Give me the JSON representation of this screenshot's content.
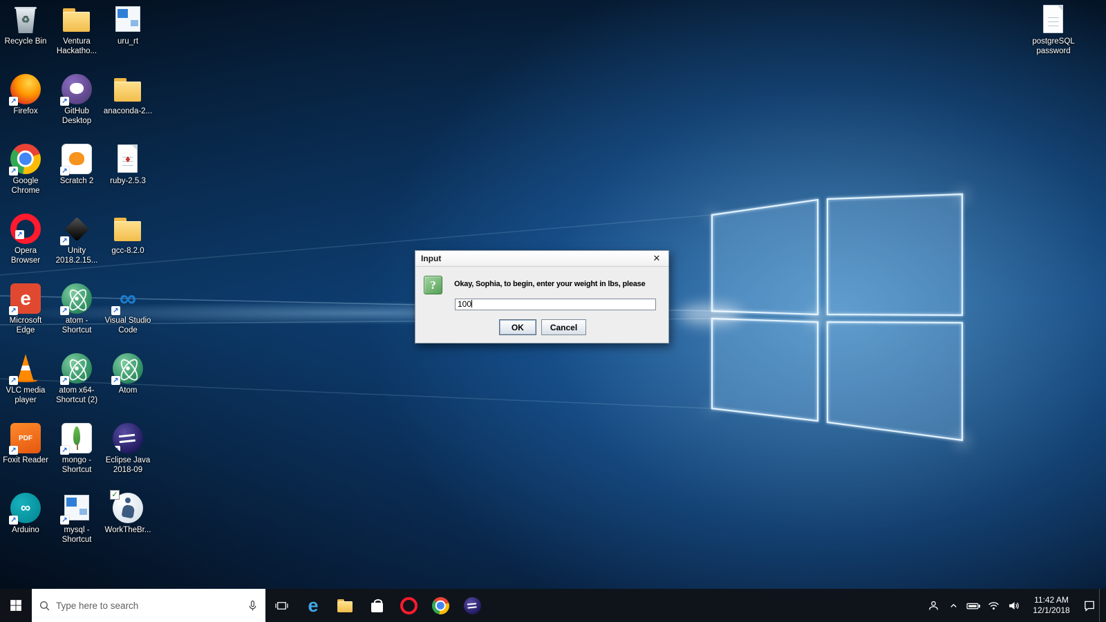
{
  "colors": {
    "taskbar_bg": "#10141a",
    "dialog_bg": "#eeeeee",
    "accent_blue": "#2f7fd6",
    "opera_red": "#ff1b2d",
    "folder_yellow": "#f2bd4c"
  },
  "dialog": {
    "title": "Input",
    "close_glyph": "✕",
    "icon_glyph": "?",
    "message": "Okay, Sophia, to begin, enter your weight in lbs, please",
    "input_value": "100",
    "buttons": {
      "ok": "OK",
      "cancel": "Cancel"
    }
  },
  "taskbar": {
    "search_placeholder": "Type here to search",
    "left_icons": [
      "windows-start",
      "search",
      "microphone",
      "task-view"
    ],
    "apps": [
      {
        "id": "edge",
        "shape": "plain",
        "glyph": "e",
        "glyphColor": "#41a8e8",
        "glyphSize": 27
      },
      {
        "id": "file-explorer",
        "shape": "folder"
      },
      {
        "id": "store",
        "shape": "bag"
      },
      {
        "id": "opera",
        "shape": "ring",
        "color": "#ff1b2d"
      },
      {
        "id": "chrome",
        "shape": "chrome"
      },
      {
        "id": "eclipse",
        "shape": "eclipse"
      }
    ],
    "tray": [
      "people",
      "chevron-up",
      "battery",
      "network",
      "volume"
    ],
    "clock": {
      "time": "11:42 AM",
      "date": "12/1/2018"
    },
    "action_center": "action-center"
  },
  "desktop_icons": [
    {
      "id": "recycle-bin",
      "label": "Recycle Bin",
      "col": 0,
      "row": 0,
      "shape": "trash",
      "glyph": "♻",
      "glyphColor": "#44625c",
      "glyphSize": 14
    },
    {
      "id": "firefox",
      "label": "Firefox",
      "col": 0,
      "row": 1,
      "shape": "circle",
      "bg": "radial-gradient(circle at 62% 30%, #ffd54a, #ff9800 42%, #e64a19 72%, #b71c1c)",
      "badge": "shortcut"
    },
    {
      "id": "google-chrome",
      "label": "Google Chrome",
      "col": 0,
      "row": 2,
      "shape": "chrome",
      "badge": "shortcut"
    },
    {
      "id": "opera-browser",
      "label": "Opera Browser",
      "col": 0,
      "row": 3,
      "shape": "ring",
      "color": "#ff1b2d",
      "badge": "shortcut"
    },
    {
      "id": "microsoft-edge",
      "label": "Microsoft Edge",
      "col": 0,
      "row": 4,
      "shape": "square",
      "color": "#e0492f",
      "glyph": "e",
      "glyphColor": "#ffffff",
      "glyphSize": 28,
      "badge": "shortcut"
    },
    {
      "id": "vlc-media-player",
      "label": "VLC media player",
      "col": 0,
      "row": 5,
      "shape": "cone",
      "badge": "shortcut"
    },
    {
      "id": "foxit-reader",
      "label": "Foxit Reader",
      "col": 0,
      "row": 6,
      "shape": "square",
      "bg": "linear-gradient(160deg,#ff8a2a,#e4570f)",
      "glyph": "PDF",
      "glyphColor": "#ffffff",
      "glyphSize": 10,
      "badge": "shortcut"
    },
    {
      "id": "arduino",
      "label": "Arduino",
      "col": 0,
      "row": 7,
      "shape": "circle",
      "bg": "radial-gradient(circle at 35% 35%, #17b1bd, #00838f)",
      "glyph": "∞",
      "glyphColor": "#ffffff",
      "glyphSize": 20,
      "badge": "shortcut"
    },
    {
      "id": "ventura-hackathon",
      "label": "Ventura Hackatho...",
      "col": 1,
      "row": 0,
      "shape": "folder"
    },
    {
      "id": "github-desktop",
      "label": "GitHub Desktop",
      "col": 1,
      "row": 1,
      "shape": "gh",
      "badge": "shortcut"
    },
    {
      "id": "scratch-2",
      "label": "Scratch 2",
      "col": 1,
      "row": 2,
      "shape": "scratch",
      "badge": "shortcut"
    },
    {
      "id": "unity",
      "label": "Unity 2018.2.15...",
      "col": 1,
      "row": 3,
      "shape": "cube",
      "badge": "shortcut"
    },
    {
      "id": "atom-shortcut",
      "label": "atom - Shortcut",
      "col": 1,
      "row": 4,
      "shape": "atom",
      "badge": "shortcut"
    },
    {
      "id": "atom-x64-shortcut",
      "label": "atom x64-Shortcut (2)",
      "col": 1,
      "row": 5,
      "shape": "atom",
      "badge": "shortcut"
    },
    {
      "id": "mongo-shortcut",
      "label": "mongo - Shortcut",
      "col": 1,
      "row": 6,
      "shape": "leaf",
      "badge": "shortcut"
    },
    {
      "id": "mysql-shortcut",
      "label": "mysql - Shortcut",
      "col": 1,
      "row": 7,
      "shape": "window",
      "badge": "shortcut"
    },
    {
      "id": "uru-rt",
      "label": "uru_rt",
      "col": 2,
      "row": 0,
      "shape": "window"
    },
    {
      "id": "anaconda",
      "label": "anaconda-2...",
      "col": 2,
      "row": 1,
      "shape": "folder"
    },
    {
      "id": "ruby",
      "label": "ruby-2.5.3",
      "col": 2,
      "row": 2,
      "shape": "file",
      "glyph": "♦",
      "glyphColor": "#cc342d",
      "glyphSize": 15
    },
    {
      "id": "gcc",
      "label": "gcc-8.2.0",
      "col": 2,
      "row": 3,
      "shape": "folder"
    },
    {
      "id": "visual-studio-code",
      "label": "Visual Studio Code",
      "col": 2,
      "row": 4,
      "shape": "plain",
      "glyph": "∞",
      "glyphColor": "#1d7ecf",
      "glyphSize": 34,
      "badge": "shortcut"
    },
    {
      "id": "atom",
      "label": "Atom",
      "col": 2,
      "row": 5,
      "shape": "atom",
      "badge": "shortcut"
    },
    {
      "id": "eclipse-java",
      "label": "Eclipse Java 2018-09",
      "col": 2,
      "row": 6,
      "shape": "eclipse",
      "badge": "shortcut"
    },
    {
      "id": "workthebrain",
      "label": "WorkTheBr...",
      "col": 2,
      "row": 7,
      "shape": "person",
      "badge": "check"
    },
    {
      "id": "postgresql-password",
      "label": "postgreSQL password",
      "col": 3,
      "row": 0,
      "shape": "file"
    }
  ]
}
